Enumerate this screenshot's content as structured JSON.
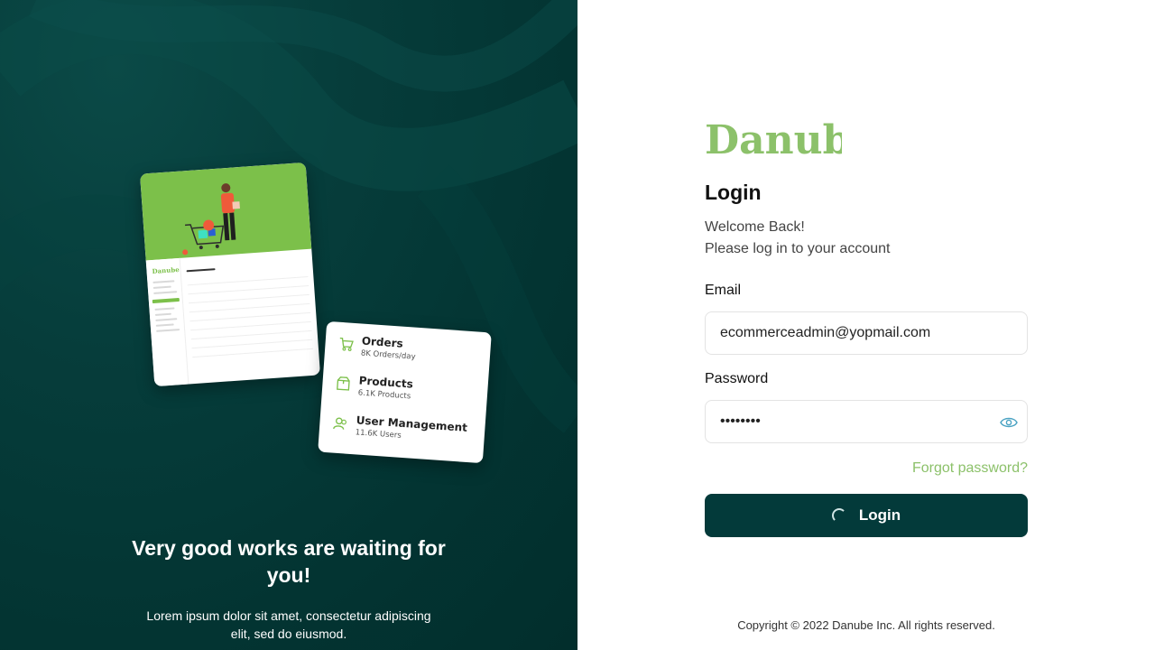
{
  "left": {
    "heading": "Very good works are waiting for you!",
    "text": "Lorem ipsum dolor sit amet, consectetur adipiscing elit, sed do eiusmod.",
    "preview_card": {
      "logo": "Danube",
      "title": "User Management"
    },
    "stats": [
      {
        "title": "Orders",
        "subtitle": "8K Orders/day",
        "icon": "cart-icon"
      },
      {
        "title": "Products",
        "subtitle": "6.1K Products",
        "icon": "box-icon"
      },
      {
        "title": "User Management",
        "subtitle": "11.6K Users",
        "icon": "users-icon"
      }
    ]
  },
  "brand": {
    "name": "Danube",
    "color": "#8cc16a"
  },
  "login": {
    "title": "Login",
    "welcome_line1": "Welcome Back!",
    "welcome_line2": "Please log in to your account",
    "email_label": "Email",
    "email_value": "ecommerceadmin@yopmail.com",
    "password_label": "Password",
    "password_value": "••••••••",
    "forgot_label": "Forgot password?",
    "button_label": "Login",
    "button_color": "#033a3a"
  },
  "footer": {
    "copyright": "Copyright © 2022 Danube Inc. All rights reserved."
  }
}
